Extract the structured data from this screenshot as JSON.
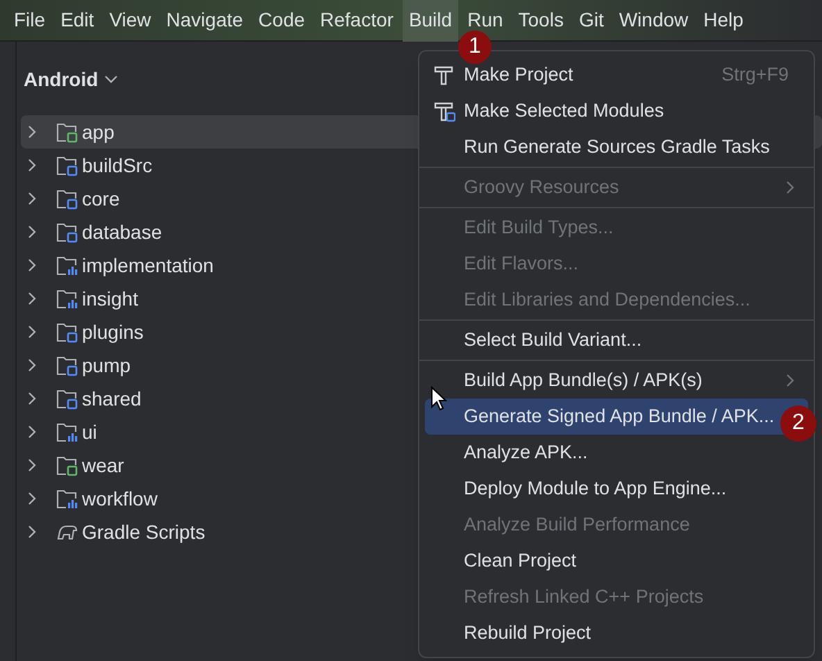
{
  "menu_bar": [
    {
      "label": "File",
      "selected": false
    },
    {
      "label": "Edit",
      "selected": false
    },
    {
      "label": "View",
      "selected": false
    },
    {
      "label": "Navigate",
      "selected": false
    },
    {
      "label": "Code",
      "selected": false
    },
    {
      "label": "Refactor",
      "selected": false
    },
    {
      "label": "Build",
      "selected": true
    },
    {
      "label": "Run",
      "selected": false
    },
    {
      "label": "Tools",
      "selected": false
    },
    {
      "label": "Git",
      "selected": false
    },
    {
      "label": "Window",
      "selected": false
    },
    {
      "label": "Help",
      "selected": false
    }
  ],
  "project_view": {
    "title": "Android",
    "tree": [
      {
        "label": "app",
        "kind": "app",
        "selected": true
      },
      {
        "label": "buildSrc",
        "kind": "library",
        "selected": false
      },
      {
        "label": "core",
        "kind": "library",
        "selected": false
      },
      {
        "label": "database",
        "kind": "library",
        "selected": false
      },
      {
        "label": "implementation",
        "kind": "feature",
        "selected": false
      },
      {
        "label": "insight",
        "kind": "feature",
        "selected": false
      },
      {
        "label": "plugins",
        "kind": "library",
        "selected": false
      },
      {
        "label": "pump",
        "kind": "library",
        "selected": false
      },
      {
        "label": "shared",
        "kind": "library",
        "selected": false
      },
      {
        "label": "ui",
        "kind": "feature",
        "selected": false
      },
      {
        "label": "wear",
        "kind": "app",
        "selected": false
      },
      {
        "label": "workflow",
        "kind": "feature",
        "selected": false
      },
      {
        "label": "Gradle Scripts",
        "kind": "gradle",
        "selected": false
      }
    ]
  },
  "build_menu": {
    "groups": [
      [
        {
          "label": "Make Project",
          "shortcut": "Strg+F9",
          "kind": "hammer",
          "disabled": false,
          "submenu": false,
          "selected": false
        },
        {
          "label": "Make Selected Modules",
          "kind": "hammer-module",
          "disabled": false,
          "submenu": false,
          "selected": false
        },
        {
          "label": "Run Generate Sources Gradle Tasks",
          "kind": "plain",
          "disabled": false,
          "submenu": false,
          "selected": false
        }
      ],
      [
        {
          "label": "Groovy Resources",
          "kind": "plain",
          "disabled": true,
          "submenu": true,
          "selected": false
        }
      ],
      [
        {
          "label": "Edit Build Types...",
          "kind": "plain",
          "disabled": true,
          "submenu": false,
          "selected": false
        },
        {
          "label": "Edit Flavors...",
          "kind": "plain",
          "disabled": true,
          "submenu": false,
          "selected": false
        },
        {
          "label": "Edit Libraries and Dependencies...",
          "kind": "plain",
          "disabled": true,
          "submenu": false,
          "selected": false
        }
      ],
      [
        {
          "label": "Select Build Variant...",
          "kind": "plain",
          "disabled": false,
          "submenu": false,
          "selected": false
        }
      ],
      [
        {
          "label": "Build App Bundle(s) / APK(s)",
          "kind": "plain",
          "disabled": false,
          "submenu": true,
          "selected": false
        },
        {
          "label": "Generate Signed App Bundle / APK...",
          "kind": "plain",
          "disabled": false,
          "submenu": false,
          "selected": true
        },
        {
          "label": "Analyze APK...",
          "kind": "plain",
          "disabled": false,
          "submenu": false,
          "selected": false
        },
        {
          "label": "Deploy Module to App Engine...",
          "kind": "plain",
          "disabled": false,
          "submenu": false,
          "selected": false
        },
        {
          "label": "Analyze Build Performance",
          "kind": "plain",
          "disabled": true,
          "submenu": false,
          "selected": false
        },
        {
          "label": "Clean Project",
          "kind": "plain",
          "disabled": false,
          "submenu": false,
          "selected": false
        },
        {
          "label": "Refresh Linked C++ Projects",
          "kind": "plain",
          "disabled": true,
          "submenu": false,
          "selected": false
        },
        {
          "label": "Rebuild Project",
          "kind": "plain",
          "disabled": false,
          "submenu": false,
          "selected": false
        }
      ]
    ]
  },
  "badges": [
    {
      "label": "1"
    },
    {
      "label": "2"
    }
  ]
}
